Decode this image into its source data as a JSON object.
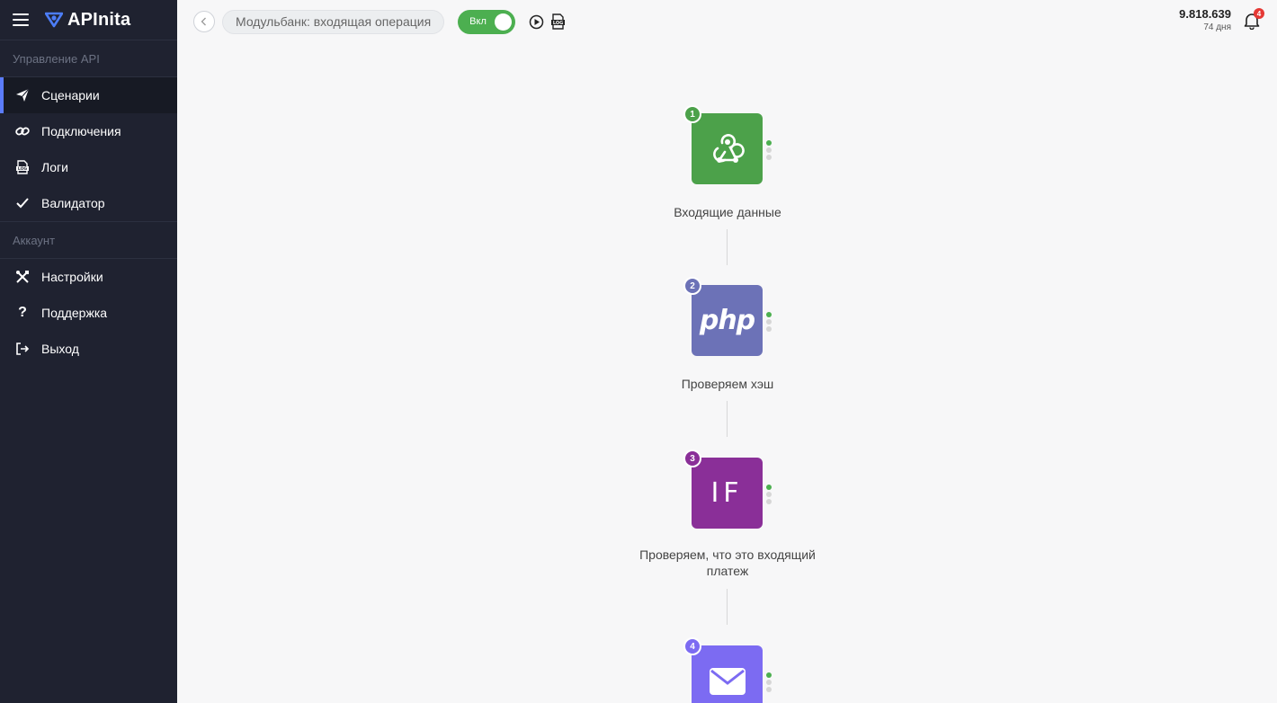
{
  "app": {
    "name": "APInita"
  },
  "sidebar": {
    "sections": [
      {
        "title": "Управление API"
      },
      {
        "title": "Аккаунт"
      }
    ],
    "items": [
      {
        "label": "Сценарии",
        "icon": "send-icon",
        "active": true
      },
      {
        "label": "Подключения",
        "icon": "link-icon"
      },
      {
        "label": "Логи",
        "icon": "log-file-icon"
      },
      {
        "label": "Валидатор",
        "icon": "check-icon"
      },
      {
        "label": "Настройки",
        "icon": "tools-icon"
      },
      {
        "label": "Поддержка",
        "icon": "question-icon"
      },
      {
        "label": "Выход",
        "icon": "logout-icon"
      }
    ]
  },
  "topbar": {
    "scenario_name": "Модульбанк: входящая операция",
    "toggle_label": "Вкл",
    "toggle_on": true,
    "balance": "9.818.639",
    "days_left": "74 дня",
    "notifications_count": "4"
  },
  "flow": {
    "nodes": [
      {
        "number": "1",
        "label": "Входящие данные",
        "type": "webhook",
        "color": "#4ca14a"
      },
      {
        "number": "2",
        "label": "Проверяем хэш",
        "type": "php",
        "text": "php",
        "color": "#6c72b7"
      },
      {
        "number": "3",
        "label": "Проверяем, что это входящий платеж",
        "type": "if",
        "text": "IF",
        "color": "#8a2f98"
      },
      {
        "number": "4",
        "label": "",
        "type": "email",
        "color": "#7c6bf2"
      }
    ]
  },
  "colors": {
    "sidebar_bg": "#1f2230",
    "accent": "#5b7cfa",
    "toggle_on": "#4caf50",
    "badge": "#e53935"
  }
}
